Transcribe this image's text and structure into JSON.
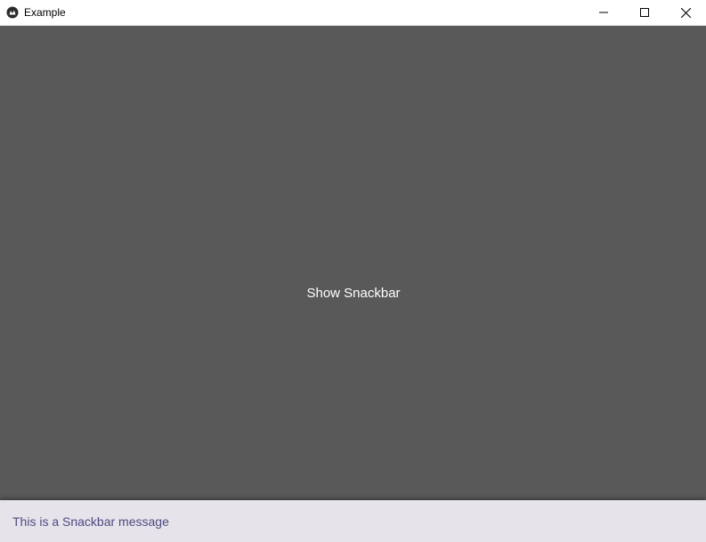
{
  "window": {
    "title": "Example",
    "app_icon": "kivy-logo-icon",
    "controls": {
      "minimize_icon": "minimize-icon",
      "maximize_icon": "maximize-icon",
      "close_icon": "close-icon"
    }
  },
  "main": {
    "background_color": "#595959",
    "button_label": "Show Snackbar",
    "button_text_color": "#ffffff"
  },
  "snackbar": {
    "message": "This is a Snackbar message",
    "background_color": "#e6e3ea",
    "text_color": "#4f4a82"
  }
}
